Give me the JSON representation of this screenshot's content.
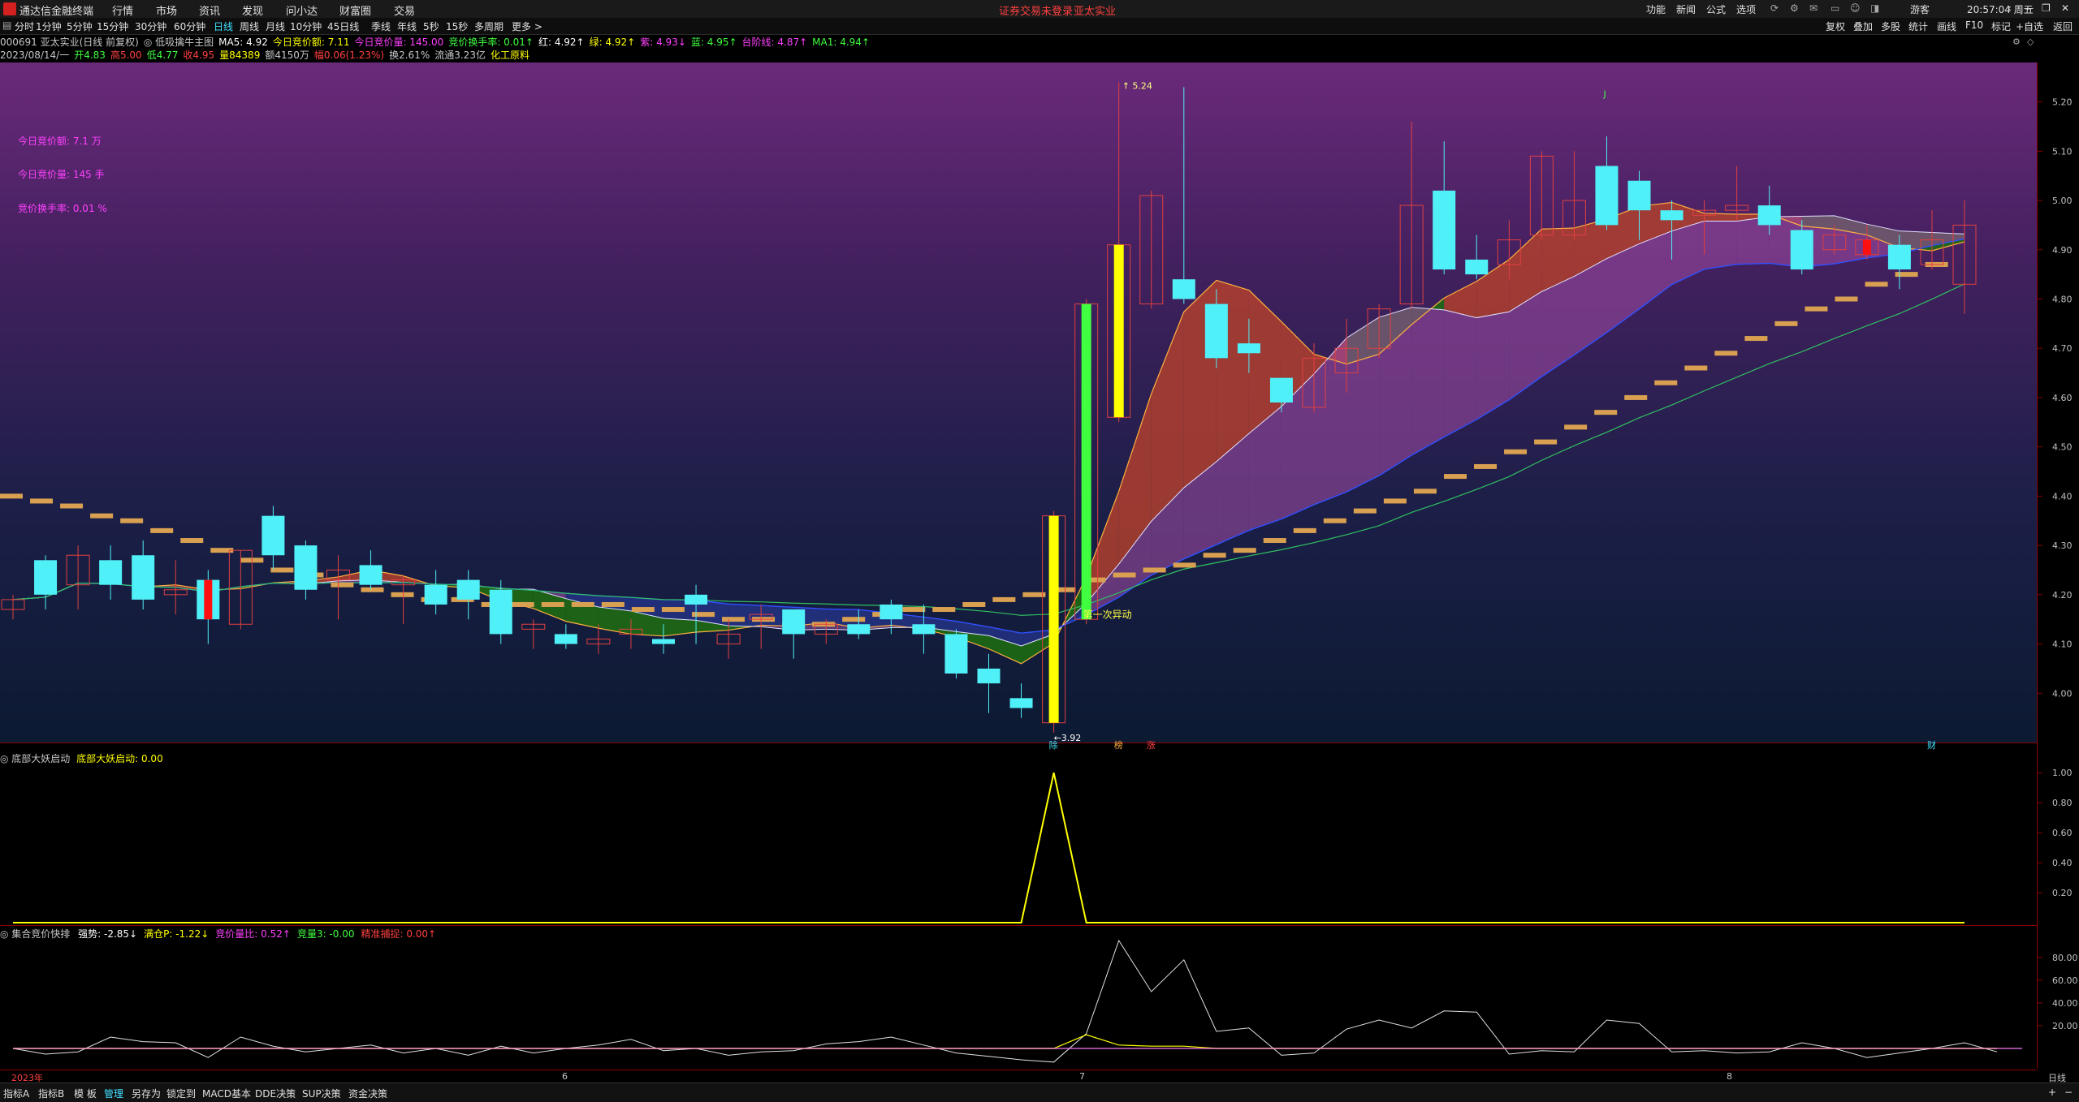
{
  "app": {
    "name": "通达信金融终端"
  },
  "menu": [
    "行情",
    "市场",
    "资讯",
    "发现",
    "问小达",
    "财富圈",
    "交易"
  ],
  "login_warning": "证券交易未登录",
  "stock_title": "亚太实业",
  "right_menu": [
    "功能",
    "新闻",
    "公式",
    "选项",
    "游客"
  ],
  "clock": "20:57:04 周五",
  "toolbar": {
    "periods": [
      "分时",
      "1分钟",
      "5分钟",
      "15分钟",
      "30分钟",
      "60分钟",
      "日线",
      "周线",
      "月线",
      "10分钟",
      "45日线",
      "季线",
      "年线",
      "5秒",
      "15秒",
      "多周期",
      "更多 >"
    ],
    "active": "日线",
    "right": [
      "复权",
      "叠加",
      "多股",
      "统计",
      "画线",
      "F10",
      "标记",
      "+自选",
      "返回"
    ]
  },
  "info_line1": [
    {
      "text": "000691 亚太实业(日线 前复权)",
      "color": "#c8c8c8"
    },
    {
      "text": "◎ 低吸擒牛主图",
      "color": "#c8c8c8"
    },
    {
      "text": "MA5: 4.92",
      "color": "#ffffff"
    },
    {
      "text": "今日竞价额: 7.11",
      "color": "#ffff00"
    },
    {
      "text": "今日竞价量: 145.00",
      "color": "#ff40ff"
    },
    {
      "text": "竞价换手率: 0.01↑",
      "color": "#40ff40"
    },
    {
      "text": "红: 4.92↑",
      "color": "#ffffff"
    },
    {
      "text": "绿: 4.92↑",
      "color": "#ffff00"
    },
    {
      "text": "紫: 4.93↓",
      "color": "#ff40ff"
    },
    {
      "text": "蓝: 4.95↑",
      "color": "#40ff40"
    },
    {
      "text": "台阶线: 4.87↑",
      "color": "#ff40ff"
    },
    {
      "text": "MA1: 4.94↑",
      "color": "#40ff40"
    }
  ],
  "info_line2": [
    {
      "text": "2023/08/14/一",
      "color": "#c8c8c8"
    },
    {
      "text": "开4.83",
      "color": "#40ff40"
    },
    {
      "text": "高5.00",
      "color": "#ff4040"
    },
    {
      "text": "低4.77",
      "color": "#40ff40"
    },
    {
      "text": "收4.95",
      "color": "#ff4040"
    },
    {
      "text": "量84389",
      "color": "#ffff00"
    },
    {
      "text": "额4150万",
      "color": "#c8c8c8"
    },
    {
      "text": "幅0.06(1.23%)",
      "color": "#ff4040"
    },
    {
      "text": "换2.61%",
      "color": "#c8c8c8"
    },
    {
      "text": "流通3.23亿",
      "color": "#c8c8c8"
    },
    {
      "text": "化工原料",
      "color": "#ffff00"
    }
  ],
  "annotations": [
    {
      "text": "今日竞价额: 7.1 万"
    },
    {
      "text": "今日竞价量: 145 手"
    },
    {
      "text": "竞价换手率: 0.01 %"
    }
  ],
  "chart_labels": {
    "high": "5.24",
    "low": "←3.92",
    "first_move": "第一次异动",
    "j_mark": "J"
  },
  "chart_markers": [
    "除",
    "榜",
    "涨",
    "财"
  ],
  "indicator1": {
    "name": "◎ 底部大妖启动",
    "value_text": "底部大妖启动: 0.00",
    "color": "#ffff00"
  },
  "indicator2": {
    "name": "◎ 集合竞价快排",
    "items": [
      {
        "text": "强势: -2.85↓",
        "color": "#ffffff"
      },
      {
        "text": "满仓P: -1.22↓",
        "color": "#ffff00"
      },
      {
        "text": "竞价量比: 0.52↑",
        "color": "#ff40ff"
      },
      {
        "text": "竞量3: -0.00",
        "color": "#40ff40"
      },
      {
        "text": "精准捕捉: 0.00↑",
        "color": "#ff4040"
      }
    ]
  },
  "date_axis": [
    {
      "label": "2023年",
      "color": "#ff4040"
    },
    {
      "label": "6",
      "color": "#c8c8c8"
    },
    {
      "label": "7",
      "color": "#c8c8c8"
    },
    {
      "label": "8",
      "color": "#c8c8c8"
    }
  ],
  "period_label": "日线",
  "bottom_tabs": [
    "指标A",
    "指标B",
    "模 板",
    "管理",
    "另存为",
    "锁定到",
    "MACD基本",
    "DDE决策",
    "SUP决策",
    "资金决策"
  ],
  "bottom_active": "管理",
  "chart_data": [
    {
      "type": "candlestick",
      "y_axis": [
        "5.20",
        "5.10",
        "5.00",
        "4.90",
        "4.80",
        "4.70",
        "4.60",
        "4.50",
        "4.40",
        "4.30",
        "4.20",
        "4.10",
        "4.00"
      ],
      "ylim": [
        3.9,
        5.28
      ],
      "candles": [
        [
          4.17,
          4.2,
          4.15,
          4.19
        ],
        [
          4.27,
          4.28,
          4.17,
          4.2
        ],
        [
          4.22,
          4.3,
          4.17,
          4.28
        ],
        [
          4.27,
          4.3,
          4.19,
          4.22
        ],
        [
          4.28,
          4.31,
          4.17,
          4.19
        ],
        [
          4.2,
          4.27,
          4.16,
          4.21
        ],
        [
          4.23,
          4.25,
          4.1,
          4.15
        ],
        [
          4.14,
          4.29,
          4.13,
          4.29
        ],
        [
          4.36,
          4.38,
          4.25,
          4.28
        ],
        [
          4.3,
          4.31,
          4.19,
          4.21
        ],
        [
          4.23,
          4.28,
          4.15,
          4.25
        ],
        [
          4.26,
          4.29,
          4.21,
          4.22
        ],
        [
          4.22,
          4.24,
          4.14,
          4.23
        ],
        [
          4.22,
          4.25,
          4.16,
          4.18
        ],
        [
          4.23,
          4.25,
          4.15,
          4.19
        ],
        [
          4.21,
          4.23,
          4.1,
          4.12
        ],
        [
          4.13,
          4.15,
          4.09,
          4.14
        ],
        [
          4.12,
          4.14,
          4.09,
          4.1
        ],
        [
          4.1,
          4.14,
          4.08,
          4.11
        ],
        [
          4.12,
          4.15,
          4.09,
          4.13
        ],
        [
          4.11,
          4.14,
          4.08,
          4.1
        ],
        [
          4.2,
          4.22,
          4.1,
          4.18
        ],
        [
          4.1,
          4.15,
          4.07,
          4.12
        ],
        [
          4.15,
          4.18,
          4.09,
          4.16
        ],
        [
          4.17,
          4.17,
          4.07,
          4.12
        ],
        [
          4.12,
          4.15,
          4.1,
          4.14
        ],
        [
          4.14,
          4.17,
          4.11,
          4.12
        ],
        [
          4.18,
          4.19,
          4.12,
          4.15
        ],
        [
          4.14,
          4.18,
          4.08,
          4.12
        ],
        [
          4.12,
          4.13,
          4.03,
          4.04
        ],
        [
          4.05,
          4.08,
          3.96,
          4.02
        ],
        [
          3.99,
          4.02,
          3.95,
          3.97
        ],
        [
          3.94,
          4.37,
          3.92,
          4.36
        ],
        [
          4.15,
          4.8,
          4.14,
          4.79
        ],
        [
          4.56,
          5.24,
          4.55,
          4.91
        ],
        [
          4.79,
          5.02,
          4.78,
          5.01
        ],
        [
          4.84,
          5.23,
          4.79,
          4.8
        ],
        [
          4.79,
          4.82,
          4.66,
          4.68
        ],
        [
          4.71,
          4.76,
          4.65,
          4.69
        ],
        [
          4.64,
          4.64,
          4.57,
          4.59
        ],
        [
          4.58,
          4.71,
          4.57,
          4.68
        ],
        [
          4.65,
          4.76,
          4.61,
          4.7
        ],
        [
          4.7,
          4.79,
          4.68,
          4.78
        ],
        [
          4.79,
          5.16,
          4.78,
          4.99
        ],
        [
          5.02,
          5.12,
          4.85,
          4.86
        ],
        [
          4.88,
          4.93,
          4.84,
          4.85
        ],
        [
          4.87,
          4.96,
          4.84,
          4.92
        ],
        [
          4.93,
          5.1,
          4.92,
          5.09
        ],
        [
          4.93,
          5.1,
          4.92,
          5.0
        ],
        [
          5.07,
          5.13,
          4.94,
          4.95
        ],
        [
          5.04,
          5.06,
          4.92,
          4.98
        ],
        [
          4.98,
          5.0,
          4.88,
          4.96
        ],
        [
          4.97,
          5.0,
          4.89,
          4.98
        ],
        [
          4.98,
          5.07,
          4.96,
          4.99
        ],
        [
          4.99,
          5.03,
          4.93,
          4.95
        ],
        [
          4.94,
          4.96,
          4.85,
          4.86
        ],
        [
          4.9,
          4.95,
          4.89,
          4.93
        ],
        [
          4.89,
          4.95,
          4.88,
          4.92
        ],
        [
          4.91,
          4.93,
          4.82,
          4.86
        ],
        [
          4.87,
          4.98,
          4.86,
          4.92
        ],
        [
          4.83,
          5.0,
          4.77,
          4.95
        ]
      ],
      "step_line": [
        4.4,
        4.39,
        4.38,
        4.36,
        4.35,
        4.33,
        4.31,
        4.29,
        4.27,
        4.25,
        4.24,
        4.22,
        4.21,
        4.2,
        4.19,
        4.19,
        4.18,
        4.18,
        4.18,
        4.18,
        4.18,
        4.17,
        4.17,
        4.16,
        4.15,
        4.15,
        4.14,
        4.14,
        4.15,
        4.16,
        4.17,
        4.17,
        4.18,
        4.19,
        4.2,
        4.21,
        4.23,
        4.24,
        4.25,
        4.26,
        4.28,
        4.29,
        4.31,
        4.33,
        4.35,
        4.37,
        4.39,
        4.41,
        4.44,
        4.46,
        4.49,
        4.51,
        4.54,
        4.57,
        4.6,
        4.63,
        4.66,
        4.69,
        4.72,
        4.75,
        4.78,
        4.8,
        4.83,
        4.85,
        4.87
      ]
    },
    {
      "type": "line",
      "name": "底部大妖启动",
      "y_axis": [
        "1.00",
        "0.80",
        "0.60",
        "0.40",
        "0.20"
      ],
      "ylim": [
        0,
        1.05
      ],
      "values": [
        0,
        0,
        0,
        0,
        0,
        0,
        0,
        0,
        0,
        0,
        0,
        0,
        0,
        0,
        0,
        0,
        0,
        0,
        0,
        0,
        0,
        0,
        0,
        0,
        0,
        0,
        0,
        0,
        0,
        0,
        0,
        0,
        1,
        0,
        0,
        0,
        0,
        0,
        0,
        0,
        0,
        0,
        0,
        0,
        0,
        0,
        0,
        0,
        0,
        0,
        0,
        0,
        0,
        0,
        0,
        0,
        0,
        0,
        0,
        0,
        0,
        0,
        0
      ]
    },
    {
      "type": "line",
      "name": "集合竞价快排",
      "y_axis": [
        "80.00",
        "60.00",
        "40.00",
        "20.00"
      ],
      "ylim": [
        -15,
        100
      ],
      "series": [
        {
          "color": "#e0e0e0",
          "values": [
            0,
            -5,
            -3,
            10,
            6,
            5,
            -8,
            10,
            2,
            -3,
            0,
            3,
            -4,
            0,
            -6,
            2,
            -4,
            0,
            3,
            8,
            -2,
            0,
            -6,
            -3,
            -2,
            4,
            6,
            10,
            3,
            -4,
            -7,
            -10,
            -12,
            13,
            95,
            50,
            78,
            15,
            18,
            -6,
            -4,
            17,
            25,
            18,
            33,
            32,
            -5,
            -2,
            -3,
            25,
            22,
            -3,
            -2,
            -4,
            -3,
            5,
            0,
            -8,
            -4,
            0,
            5,
            -3
          ]
        },
        {
          "color": "#ffff00",
          "values": [
            0,
            0,
            0,
            0,
            0,
            0,
            0,
            0,
            0,
            0,
            0,
            0,
            0,
            0,
            0,
            0,
            0,
            0,
            0,
            0,
            0,
            0,
            0,
            0,
            0,
            0,
            0,
            0,
            0,
            0,
            0,
            0,
            0,
            12,
            3,
            2,
            2,
            0,
            0,
            0,
            0,
            0,
            0,
            0,
            0,
            0,
            0,
            0,
            0,
            0,
            0,
            0,
            0,
            0,
            0,
            0,
            0,
            0,
            0,
            0,
            0,
            0
          ]
        }
      ]
    }
  ]
}
